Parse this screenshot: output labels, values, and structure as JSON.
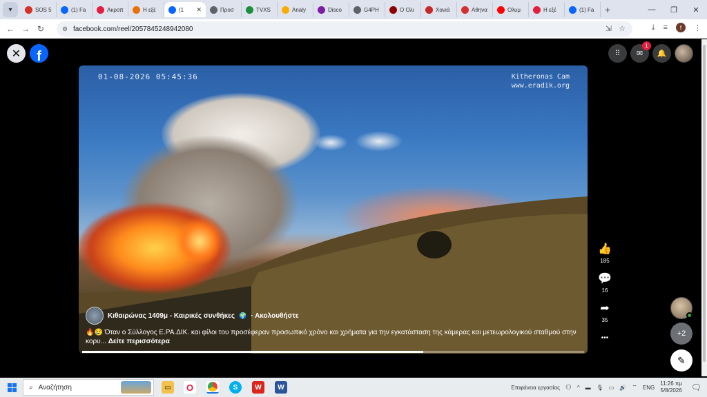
{
  "browser": {
    "tabs": [
      {
        "label": "SOS 5",
        "icon": "gmail-icon",
        "color": "#d93025"
      },
      {
        "label": "(1) Fa",
        "icon": "facebook-icon",
        "color": "#0866ff"
      },
      {
        "label": "Ακροπ",
        "icon": "opera-icon",
        "color": "#e41e3f"
      },
      {
        "label": "Η εξέ",
        "icon": "news-icon",
        "color": "#e8710a"
      },
      {
        "label": "(1",
        "icon": "facebook-icon",
        "color": "#0866ff",
        "active": true
      },
      {
        "label": "Προσ",
        "icon": "globe-icon",
        "color": "#5f6368"
      },
      {
        "label": "TVXS",
        "icon": "tvxs-icon",
        "color": "#1e8e3e"
      },
      {
        "label": "Analy",
        "icon": "analytics-icon",
        "color": "#f9ab00"
      },
      {
        "label": "Disco",
        "icon": "discover-icon",
        "color": "#7b1fa2"
      },
      {
        "label": "G4PH",
        "icon": "globe-icon",
        "color": "#5f6368"
      },
      {
        "label": "Ο Ολι",
        "icon": "news-icon",
        "color": "#8b0000"
      },
      {
        "label": "Χανιά",
        "icon": "news-icon",
        "color": "#c62828"
      },
      {
        "label": "Αθηνα",
        "icon": "news-icon",
        "color": "#d32f2f"
      },
      {
        "label": "Ολυμ",
        "icon": "youtube-icon",
        "color": "#ff0000"
      },
      {
        "label": "Η εξέ",
        "icon": "opera-icon",
        "color": "#e41e3f"
      },
      {
        "label": "(1) Fa",
        "icon": "facebook-icon",
        "color": "#0866ff"
      }
    ],
    "url": "facebook.com/reel/2057845248942080",
    "profile_initial": "f"
  },
  "facebook": {
    "messenger_badge": "1"
  },
  "video": {
    "timestamp": "01-08-2026 05:45:36",
    "cam_line1": "Kitheronas Cam",
    "cam_line2": "www.eradik.org",
    "author": "Κιθαιρώνας 1409μ - Καιρικές συνθήκες",
    "globe": "🌍",
    "follow": "· Ακολουθήστε",
    "caption_emoji": "🔥😢",
    "caption": "Όταν ο Σύλλογος Ε.ΡΑ.ΔΙΚ. και φίλοι του προσέφεραν προσωπικό χρόνο και χρήματα για την εγκατάσταση της κάμερας και μετεωρολογικού σταθμού στην κορυ...",
    "see_more": "Δείτε περισσότερα",
    "progress": 0.68
  },
  "actions": {
    "likes": "185",
    "comments": "16",
    "shares": "35",
    "more": "•••"
  },
  "side": {
    "extra_count": "+2"
  },
  "taskbar": {
    "search_placeholder": "Αναζήτηση",
    "desktop_label": "Επιφάνεια εργασίας",
    "lang": "ENG",
    "time": "11:26 πμ",
    "date": "5/8/2026"
  }
}
